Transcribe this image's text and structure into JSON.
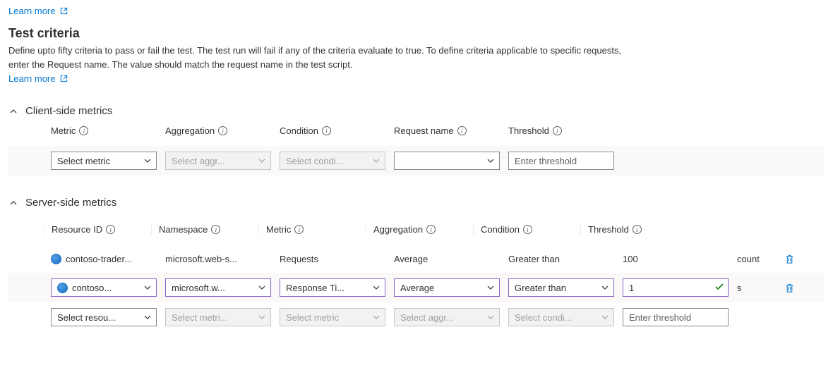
{
  "top_learn_more": "Learn more",
  "heading": "Test criteria",
  "description": "Define upto fifty criteria to pass or fail the test. The test run will fail if any of the criteria evaluate to true. To define criteria applicable to specific requests, enter the Request name. The value should match the request name in the test script.",
  "desc_learn_more": "Learn more",
  "sections": {
    "client": "Client-side metrics",
    "server": "Server-side metrics"
  },
  "client_headers": {
    "metric": "Metric",
    "aggregation": "Aggregation",
    "condition": "Condition",
    "request_name": "Request name",
    "threshold": "Threshold"
  },
  "client_row": {
    "metric_placeholder": "Select metric",
    "agg_placeholder": "Select aggr...",
    "cond_placeholder": "Select condi...",
    "req_value": "",
    "thr_placeholder": "Enter threshold"
  },
  "server_headers": {
    "resource_id": "Resource ID",
    "namespace": "Namespace",
    "metric": "Metric",
    "aggregation": "Aggregation",
    "condition": "Condition",
    "threshold": "Threshold"
  },
  "server_rows": {
    "r1": {
      "resource": "contoso-trader...",
      "namespace": "microsoft.web-s...",
      "metric": "Requests",
      "aggregation": "Average",
      "condition": "Greater than",
      "threshold": "100",
      "unit": "count"
    },
    "r2": {
      "resource": "contoso...",
      "namespace": "microsoft.w...",
      "metric": "Response Ti...",
      "aggregation": "Average",
      "condition": "Greater than",
      "threshold": "1",
      "unit": "s"
    },
    "r3": {
      "resource_placeholder": "Select resou...",
      "namespace_placeholder": "Select metri...",
      "metric_placeholder": "Select metric",
      "agg_placeholder": "Select aggr...",
      "cond_placeholder": "Select condi...",
      "thr_placeholder": "Enter threshold"
    }
  }
}
